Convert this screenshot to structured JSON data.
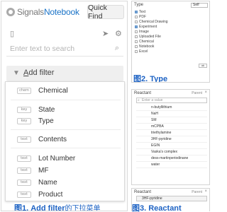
{
  "app": {
    "logo_prefix": "Signals",
    "logo_suffix": "Notebook",
    "quick_find": "Quick Find",
    "search_placeholder": "Enter text to search",
    "filter_label": "Add filter"
  },
  "filter_menu": {
    "items": [
      {
        "tag": "chem",
        "label": "Chemical"
      },
      {
        "tag": "key",
        "label": "State"
      },
      {
        "tag": "key",
        "label": "Type"
      },
      {
        "tag": "text",
        "label": "Contents"
      },
      {
        "tag": "text",
        "label": "Lot Number"
      },
      {
        "tag": "text",
        "label": "MF"
      },
      {
        "tag": "text",
        "label": "Name"
      },
      {
        "tag": "text",
        "label": "Product"
      }
    ]
  },
  "captions": {
    "fig1_main": "图1. Add filter",
    "fig1_sub": "的下拉菜单",
    "fig2": "图2. Type",
    "fig3": "图3. Reactant"
  },
  "type_panel": {
    "title": "Type",
    "self_label": "Self",
    "ok": "ok",
    "options": [
      {
        "label": "Text",
        "checked": true
      },
      {
        "label": "PDF",
        "checked": false
      },
      {
        "label": "Chemical Drawing",
        "checked": false
      },
      {
        "label": "Experiment",
        "checked": true
      },
      {
        "label": "Image",
        "checked": false
      },
      {
        "label": "Uploaded File",
        "checked": false
      },
      {
        "label": "Chemical",
        "checked": false
      },
      {
        "label": "Notebook",
        "checked": false
      },
      {
        "label": "Excel",
        "checked": false
      }
    ]
  },
  "reactant_panel": {
    "title": "Reactant",
    "parent_label": "Parent",
    "input_placeholder": "Enter a value",
    "values": [
      "n-butyllithium",
      "NaH",
      "SM",
      "mCPBA",
      "triethylamine",
      "3HF-pyridine",
      "EGIN",
      "Vaska's complex",
      "dess-martinperiodinane",
      "water"
    ]
  },
  "reactant_panel2": {
    "title": "Reactant",
    "parent_label": "Parent",
    "value": "3HF-pyridine"
  },
  "colors": {
    "accent_blue": "#1a73c7",
    "caption_blue": "#1e63c4"
  }
}
